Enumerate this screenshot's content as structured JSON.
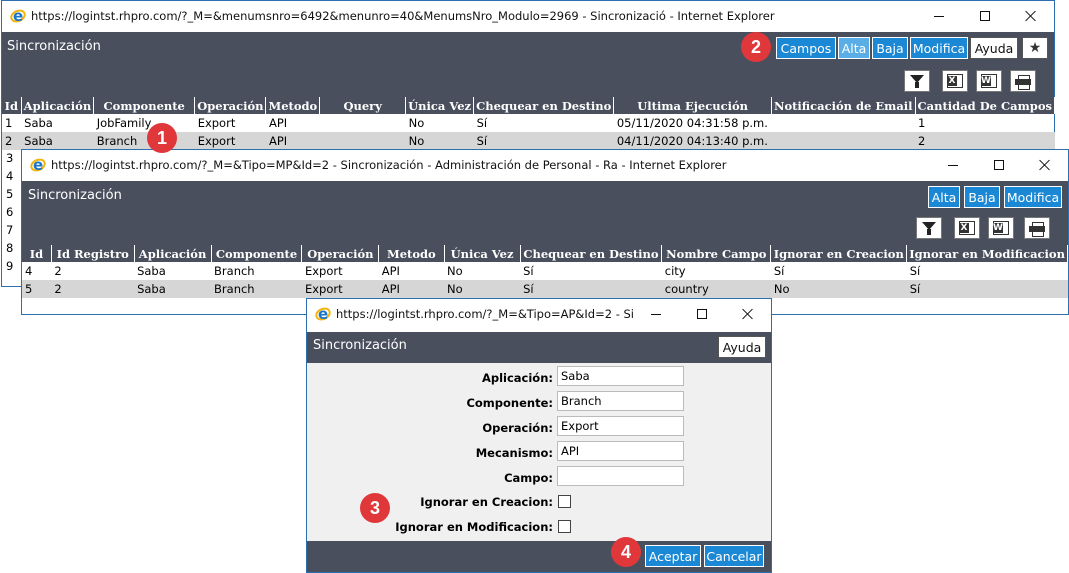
{
  "win1": {
    "title": "https://logintst.rhpro.com/?_M=&menumsnro=6492&menunro=40&MenumsNro_Modulo=2969 - Sincronizació - Internet Explorer",
    "header_title": "Sincronización",
    "buttons": {
      "campos": "Campos",
      "alta": "Alta",
      "baja": "Baja",
      "modifica": "Modifica",
      "ayuda": "Ayuda"
    },
    "columns": [
      "Id",
      "Aplicación",
      "Componente",
      "Operación",
      "Metodo",
      "Query",
      "Única Vez",
      "Chequear en Destino",
      "Ultima Ejecución",
      "Notificación de Email",
      "Cantidad De Campos"
    ],
    "rows": [
      [
        "1",
        "Saba",
        "JobFamily",
        "Export",
        "API",
        "",
        "No",
        "Sí",
        "05/11/2020 04:31:58 p.m.",
        "",
        "1"
      ],
      [
        "2",
        "Saba",
        "Branch",
        "Export",
        "API",
        "",
        "No",
        "Sí",
        "04/11/2020 04:13:40 p.m.",
        "",
        "2"
      ]
    ],
    "extra_row_ids": [
      "3",
      "4",
      "5",
      "6",
      "7",
      "8",
      "9"
    ]
  },
  "win2": {
    "title": "https://logintst.rhpro.com/?_M=&Tipo=MP&Id=2 - Sincronización - Administración de Personal - Ra - Internet Explorer",
    "header_title": "Sincronización",
    "buttons": {
      "alta": "Alta",
      "baja": "Baja",
      "modifica": "Modifica"
    },
    "columns": [
      "Id",
      "Id Registro",
      "Aplicación",
      "Componente",
      "Operación",
      "Metodo",
      "Única Vez",
      "Chequear en Destino",
      "Nombre Campo",
      "Ignorar en Creacion",
      "Ignorar en Modificacion"
    ],
    "rows": [
      [
        "4",
        "2",
        "Saba",
        "Branch",
        "Export",
        "API",
        "No",
        "Sí",
        "city",
        "Sí",
        "Sí"
      ],
      [
        "5",
        "2",
        "Saba",
        "Branch",
        "Export",
        "API",
        "No",
        "Sí",
        "country",
        "No",
        "Sí"
      ]
    ]
  },
  "win3": {
    "title": "https://logintst.rhpro.com/?_M=&Tipo=AP&Id=2 - Si...",
    "header_title": "Sincronización",
    "ayuda": "Ayuda",
    "fields": {
      "aplicacion_label": "Aplicación:",
      "aplicacion_value": "Saba",
      "componente_label": "Componente:",
      "componente_value": "Branch",
      "operacion_label": "Operación:",
      "operacion_value": "Export",
      "mecanismo_label": "Mecanismo:",
      "mecanismo_value": "API",
      "campo_label": "Campo:",
      "campo_value": "",
      "ignorar_creacion_label": "Ignorar en Creacion:",
      "ignorar_modificacion_label": "Ignorar en Modificacion:"
    },
    "aceptar": "Aceptar",
    "cancelar": "Cancelar"
  },
  "markers": {
    "m1": "1",
    "m2": "2",
    "m3": "3",
    "m4": "4"
  },
  "icons": {
    "excel": "X",
    "word": "W"
  },
  "colors": {
    "header_bg": "#4a4f5d",
    "button_blue": "#1a88d4",
    "marker_red": "#e0383a",
    "row_alt": "#d6d6d6"
  }
}
